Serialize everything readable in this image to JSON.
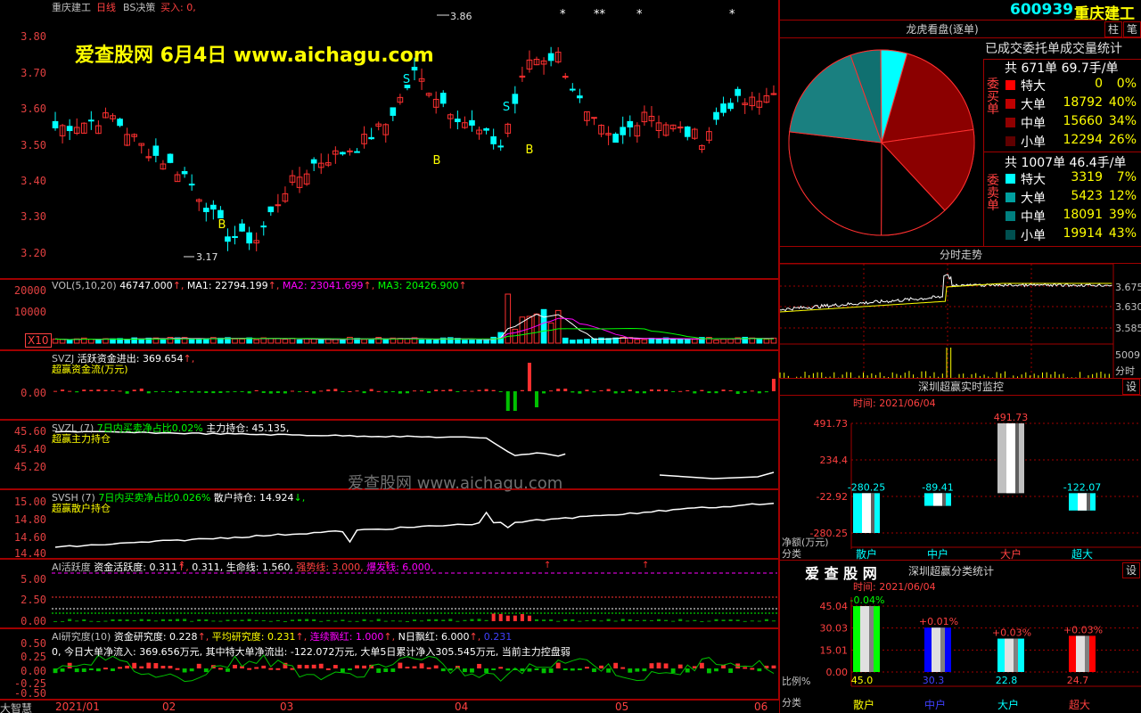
{
  "main_chart": {
    "title": "重庆建工",
    "period": "日线",
    "indicator": "BS决策",
    "buy_label": "买入: 0,",
    "high_label": "3.86",
    "low_label": "3.17",
    "y_ticks": [
      "3.80",
      "3.70",
      "3.60",
      "3.50",
      "3.40",
      "3.30",
      "3.20"
    ],
    "signals": [
      "S",
      "B",
      "S",
      "B",
      "B"
    ],
    "watermark": "爱查股网    6月4日    www.aichagu.com",
    "stars": [
      "*",
      "**",
      "*",
      "*",
      "*"
    ]
  },
  "vol_panel": {
    "label": "VOL(5,10,20)",
    "value": "46747.000",
    "ma1_label": "MA1: 22794.199",
    "ma2_label": "MA2: 23041.699",
    "ma3_label": "MA3: 20426.900",
    "y_ticks": [
      "20000",
      "10000"
    ],
    "unit": "X10"
  },
  "svzj_panel": {
    "label": "SVZJ",
    "desc": "活跃资金进出: 369.654",
    "name": "超赢资金流(万元)",
    "y_tick": "0.00"
  },
  "svzl_panel": {
    "label": "SVZL (7)",
    "desc1": "7日内买卖净占比0.02%",
    "desc2": "主力持仓: 45.135",
    "name": "超赢主力持仓",
    "y_ticks": [
      "45.60",
      "45.40",
      "45.20"
    ],
    "watermark": "爱查股网    www.aichagu.com"
  },
  "svsh_panel": {
    "label": "SVSH (7)",
    "desc1": "7日内买卖净占比0.026%",
    "desc2": "散户持仓: 14.924",
    "name": "超赢散户持仓",
    "y_ticks": [
      "15.00",
      "14.80",
      "14.60",
      "14.40"
    ]
  },
  "ai_active_panel": {
    "label": "AI活跃度",
    "desc1": "资金活跃度: 0.311",
    "desc2": "0.311,",
    "desc3": "生命线: 1.560,",
    "desc4": "强势线: 3.000,",
    "desc5": "爆发线: 6.000,",
    "y_ticks": [
      "5.00",
      "2.50",
      "0.00"
    ]
  },
  "ai_research_panel": {
    "label": "AI研究度(10)",
    "desc1": "资金研究度: 0.228",
    "desc2": "平均研究度: 0.231",
    "desc3": "连续飘红: 1.000",
    "desc4": "N日飘红: 6.000",
    "desc5": "0.231",
    "info": "0, 今日大单净流入: 369.656万元, 其中特大单净流出: -122.072万元, 大单5日累计净入305.545万元, 当前主力控盘弱",
    "y_ticks": [
      "0.50",
      "0.25",
      "0.00",
      "-0.25",
      "-0.50"
    ]
  },
  "x_axis": {
    "labels": [
      "2021/01",
      "02",
      "03",
      "04",
      "05",
      "06"
    ],
    "corner": "大智慧"
  },
  "right_panel": {
    "code": "600939",
    "name": "重庆建工",
    "btn1": "柱",
    "btn2": "笔",
    "longhu_title": "龙虎看盘(逐单)",
    "stats_title": "已成交委托单成交量统计",
    "buy_side": "委买单",
    "buy_summary": "共 671单 69.7手/单",
    "buy_rows": [
      {
        "label": "特大",
        "vol": "0",
        "pct": "0%",
        "color": "#ff0000"
      },
      {
        "label": "大单",
        "vol": "18792",
        "pct": "40%",
        "color": "#c00000"
      },
      {
        "label": "中单",
        "vol": "15660",
        "pct": "34%",
        "color": "#900000"
      },
      {
        "label": "小单",
        "vol": "12294",
        "pct": "26%",
        "color": "#600000"
      }
    ],
    "sell_side": "委卖单",
    "sell_summary": "共 1007单 46.4手/单",
    "sell_rows": [
      {
        "label": "特大",
        "vol": "3319",
        "pct": "7%",
        "color": "#00ffff"
      },
      {
        "label": "大单",
        "vol": "5423",
        "pct": "12%",
        "color": "#00a0a0"
      },
      {
        "label": "中单",
        "vol": "18091",
        "pct": "39%",
        "color": "#008080"
      },
      {
        "label": "小单",
        "vol": "19914",
        "pct": "43%",
        "color": "#005050"
      }
    ],
    "pie_slices": [
      {
        "name": "buy-large",
        "pct": 18.3,
        "color": "#8b0000"
      },
      {
        "name": "buy-mid",
        "pct": 15.3,
        "color": "#8b0000"
      },
      {
        "name": "buy-small",
        "pct": 12.0,
        "color": "#000000"
      },
      {
        "name": "sell-mid",
        "pct": 26.8,
        "color": "#000000"
      },
      {
        "name": "sell-small",
        "pct": 17.7,
        "color": "#1a8080"
      },
      {
        "name": "sell-large",
        "pct": 5.3,
        "color": "#107070"
      },
      {
        "name": "sell-super",
        "pct": 4.6,
        "color": "#00ffff"
      }
    ],
    "intraday_title": "分时走势",
    "intraday_ticks": [
      "3.675",
      "3.630",
      "3.585"
    ],
    "intraday_vol": "5009",
    "intraday_unit": "分时",
    "monitor_title": "深圳超赢实时监控",
    "set_btn": "设",
    "monitor_time": "时间: 2021/06/04",
    "monitor_yticks": [
      "491.73",
      "234.4",
      "-22.92",
      "-280.25"
    ],
    "monitor_ylabel": "净额(万元)",
    "monitor_xlabel": "分类",
    "monitor_cats": [
      "散户",
      "中户",
      "大户",
      "超大"
    ],
    "monitor_values": [
      -280.25,
      -89.41,
      491.73,
      -122.07
    ],
    "monitor_value_labels": [
      "-280.25",
      "-89.41",
      "491.73",
      "-122.07"
    ],
    "stat_brand": "爱 查 股 网",
    "stat_title": "深圳超赢分类统计",
    "stat_time": "时间: 2021/06/04",
    "stat_yticks": [
      "45.04",
      "30.03",
      "15.01",
      "0.00"
    ],
    "stat_ylabel": "比例%",
    "stat_xlabel": "分类",
    "stat_cats": [
      "散户",
      "中户",
      "大户",
      "超大"
    ],
    "stat_values": [
      45.0,
      30.3,
      22.8,
      24.7
    ],
    "stat_value_labels": [
      "45.0",
      "30.3",
      "22.8",
      "24.7"
    ],
    "stat_changes": [
      "-0.04%",
      "+0.01%",
      "+0.03%",
      "+0.03%"
    ],
    "stat_colors": [
      "#00ff00",
      "#0000ff",
      "#00ffff",
      "#ff0000"
    ]
  },
  "chart_data": [
    {
      "type": "candlestick",
      "title": "重庆建工 日线",
      "y_range": [
        3.15,
        3.88
      ],
      "x_labels": [
        "2021/01",
        "02",
        "03",
        "04",
        "05",
        "06"
      ],
      "high": 3.86,
      "low": 3.17
    },
    {
      "type": "bar",
      "title": "深圳超赢实时监控",
      "categories": [
        "散户",
        "中户",
        "大户",
        "超大"
      ],
      "values": [
        -280.25,
        -89.41,
        491.73,
        -122.07
      ],
      "ylabel": "净额(万元)"
    },
    {
      "type": "bar",
      "title": "深圳超赢分类统计",
      "categories": [
        "散户",
        "中户",
        "大户",
        "超大"
      ],
      "values": [
        45.0,
        30.3,
        22.8,
        24.7
      ],
      "ylabel": "比例%"
    }
  ]
}
